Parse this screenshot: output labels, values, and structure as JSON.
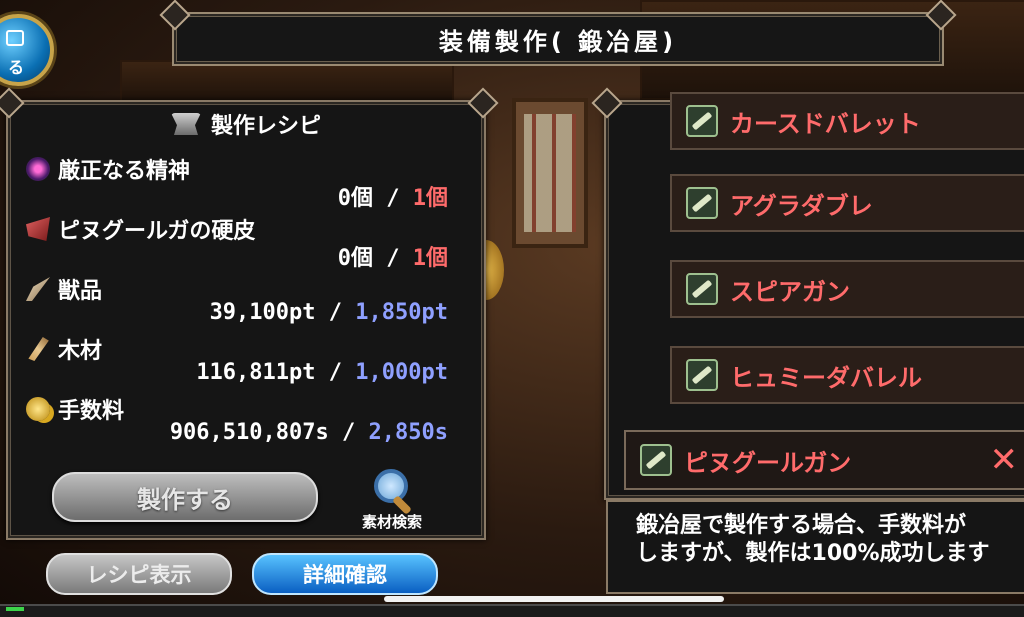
{
  "title": "装備製作(  鍛冶屋)",
  "top_button_label": "る",
  "recipe": {
    "header": "製作レシピ",
    "items": [
      {
        "name": "厳正なる精神",
        "icon": "spirit-orb-icon",
        "have": "0個",
        "sep": " / ",
        "need": "1個",
        "need_color": "red"
      },
      {
        "name": "ピヌグールガの硬皮",
        "icon": "hide-icon",
        "have": "0個",
        "sep": " / ",
        "need": "1個",
        "need_color": "red"
      },
      {
        "name": "獣品",
        "icon": "horn-icon",
        "have": "39,100pt",
        "sep": " / ",
        "need": "1,850pt",
        "need_color": "blue"
      },
      {
        "name": "木材",
        "icon": "wood-icon",
        "have": "116,811pt",
        "sep": " / ",
        "need": "1,000pt",
        "need_color": "blue"
      },
      {
        "name": "手数料",
        "icon": "coins-icon",
        "have": "906,510,807s",
        "sep": " / ",
        "need": "2,850s",
        "need_color": "blue"
      }
    ],
    "make_button": "製作する",
    "search_label": "素材検索"
  },
  "buttons": {
    "recipe_display": "レシピ表示",
    "details": "詳細確認"
  },
  "weapons": [
    {
      "name": "カースドバレット",
      "selected": false
    },
    {
      "name": "アグラダブレ",
      "selected": false
    },
    {
      "name": "スピアガン",
      "selected": false
    },
    {
      "name": "ヒュミーダバレル",
      "selected": false
    },
    {
      "name": "ピヌグールガン",
      "selected": true
    }
  ],
  "close_symbol": "✕",
  "description": {
    "line1": "鍛冶屋で製作する場合、手数料が",
    "line2": "しますが、製作は100%成功します"
  },
  "colors": {
    "red": "#ff6b6b",
    "blue": "#8fa0ff",
    "accent_blue": "#0a5fc2"
  }
}
